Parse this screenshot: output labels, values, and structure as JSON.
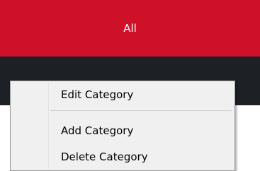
{
  "category_tab": {
    "label": "All"
  },
  "context_menu": {
    "items": [
      {
        "label": "Edit Category"
      },
      {
        "label": "Add Category"
      },
      {
        "label": "Delete Category"
      }
    ]
  },
  "colors": {
    "tab_background": "#cf1029",
    "dark_bar": "#1d2126",
    "menu_background": "#f0f0f0"
  }
}
